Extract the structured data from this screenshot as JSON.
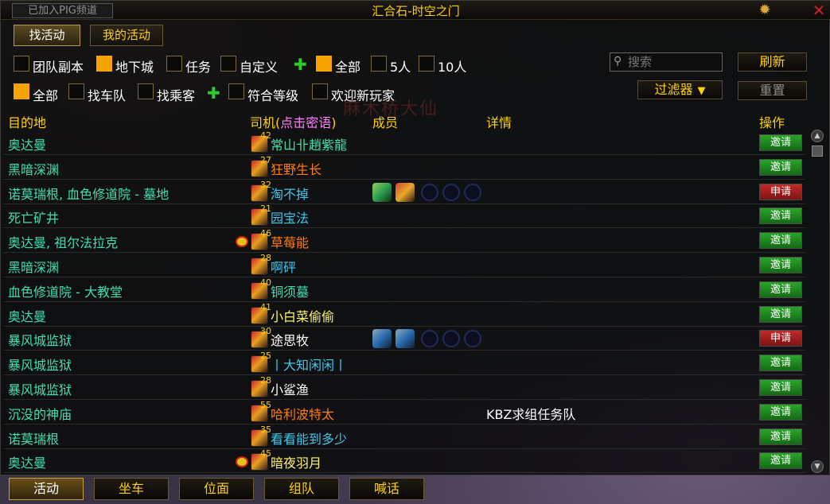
{
  "window": {
    "pig_badge": "已加入PIG频道",
    "title": "汇合石-时空之门",
    "gear_icon": "gear-icon",
    "close_icon": "close-icon"
  },
  "top_tabs": [
    {
      "label": "找活动",
      "active": true
    },
    {
      "label": "我的活动",
      "active": false
    }
  ],
  "filters_row1": [
    {
      "label": "团队副本",
      "checked": false
    },
    {
      "label": "地下城",
      "checked": true
    },
    {
      "label": "任务",
      "checked": false
    },
    {
      "label": "自定义",
      "checked": false
    },
    {
      "label": "全部",
      "checked": true
    },
    {
      "label": "5人",
      "checked": false
    },
    {
      "label": "10人",
      "checked": false
    }
  ],
  "filters_row2": [
    {
      "label": "全部",
      "checked": true
    },
    {
      "label": "找车队",
      "checked": false
    },
    {
      "label": "找乘客",
      "checked": false
    },
    {
      "label": "符合等级",
      "checked": false
    },
    {
      "label": "欢迎新玩家",
      "checked": false
    }
  ],
  "search": {
    "placeholder": "搜索"
  },
  "buttons": {
    "refresh": "刷新",
    "filter": "过滤器",
    "reset": "重置"
  },
  "columns": {
    "dest": "目的地",
    "leader_prefix": "司机(",
    "leader_hint": "点击密语",
    "leader_suffix": ")",
    "members": "成员",
    "details": "详情",
    "action": "操作"
  },
  "watermark": "麻木桥大仙",
  "rows": [
    {
      "dest": "奥达曼",
      "level": "42",
      "leader": "常山卝趙紫龍",
      "leader_color": "#3fe0b0",
      "members": [],
      "detail": "",
      "action": "邀请",
      "action_type": "invite"
    },
    {
      "dest": "黑暗深渊",
      "level": "27",
      "leader": "狂野生长",
      "leader_color": "#ff7d0a",
      "members": [],
      "detail": "",
      "action": "邀请",
      "action_type": "invite"
    },
    {
      "dest": "诺莫瑞根, 血色修道院 - 墓地",
      "level": "32",
      "leader": "淘不掉",
      "leader_color": "#3fc7eb",
      "members": [
        "green",
        "orange"
      ],
      "detail": "",
      "action": "申请",
      "action_type": "apply"
    },
    {
      "dest": "死亡矿井",
      "level": "21",
      "leader": "园宝法",
      "leader_color": "#3fc7eb",
      "members": [],
      "detail": "",
      "action": "邀请",
      "action_type": "invite"
    },
    {
      "dest": "奥达曼, 祖尔法拉克",
      "level": "46",
      "leader": "草莓能",
      "leader_color": "#ff7d0a",
      "members": [],
      "detail": "",
      "action": "邀请",
      "action_type": "invite"
    },
    {
      "dest": "黑暗深渊",
      "level": "28",
      "leader": "啊砰",
      "leader_color": "#3fc7eb",
      "members": [],
      "detail": "",
      "action": "邀请",
      "action_type": "invite"
    },
    {
      "dest": "血色修道院 - 大教堂",
      "level": "40",
      "leader": "铜须墓",
      "leader_color": "#3fe0b0",
      "members": [],
      "detail": "",
      "action": "邀请",
      "action_type": "invite"
    },
    {
      "dest": "奥达曼",
      "level": "41",
      "leader": "小白菜偷偷",
      "leader_color": "#fff569",
      "members": [],
      "detail": "",
      "action": "邀请",
      "action_type": "invite"
    },
    {
      "dest": "暴风城监狱",
      "level": "30",
      "leader": "途思牧",
      "leader_color": "#ffffff",
      "members": [
        "blue",
        "blue"
      ],
      "detail": "",
      "action": "申请",
      "action_type": "apply"
    },
    {
      "dest": "暴风城监狱",
      "level": "25",
      "leader": "丨大知闲闲丨",
      "leader_color": "#3fc7eb",
      "members": [],
      "detail": "",
      "action": "邀请",
      "action_type": "invite"
    },
    {
      "dest": "暴风城监狱",
      "level": "28",
      "leader": "小鲨渔",
      "leader_color": "#ffffff",
      "members": [],
      "detail": "",
      "action": "邀请",
      "action_type": "invite"
    },
    {
      "dest": "沉没的神庙",
      "level": "55",
      "leader": "哈利波特太",
      "leader_color": "#ff7d0a",
      "members": [],
      "detail": "KBZ求组任务队",
      "action": "邀请",
      "action_type": "invite"
    },
    {
      "dest": "诺莫瑞根",
      "level": "35",
      "leader": "看看能到多少",
      "leader_color": "#3fc7eb",
      "members": [],
      "detail": "",
      "action": "邀请",
      "action_type": "invite"
    },
    {
      "dest": "奥达曼",
      "level": "45",
      "leader": "暗夜羽月",
      "leader_color": "#fff569",
      "members": [],
      "detail": "",
      "action": "邀请",
      "action_type": "invite"
    }
  ],
  "bottom_tabs": [
    {
      "label": "活动",
      "active": true
    },
    {
      "label": "坐车",
      "active": false
    },
    {
      "label": "位面",
      "active": false
    },
    {
      "label": "组队",
      "active": false
    },
    {
      "label": "喊话",
      "active": false
    }
  ]
}
